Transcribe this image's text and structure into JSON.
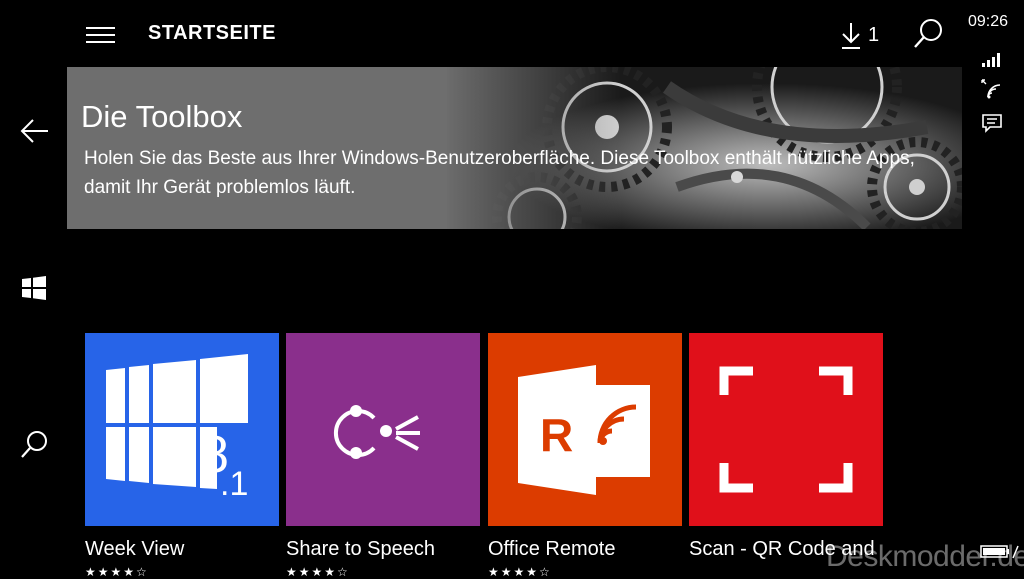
{
  "header": {
    "title": "STARTSEITE",
    "download_count": "1"
  },
  "status_bar": {
    "time": "09:26"
  },
  "hero": {
    "title": "Die Toolbox",
    "description": "Holen Sie das Beste aus Ihrer Windows-Benutzeroberfläche. Diese Toolbox enthält nützliche Apps, damit Ihr Gerät problemlos läuft."
  },
  "apps": [
    {
      "name": "Week View",
      "color": "#2764e8",
      "rating_stars": "★★★★☆"
    },
    {
      "name": "Share to Speech",
      "color": "#8a2f8c",
      "rating_stars": "★★★★☆"
    },
    {
      "name": "Office Remote",
      "color": "#dc3c00",
      "rating_stars": "★★★★☆"
    },
    {
      "name": "Scan - QR Code and",
      "color": "#e0101a",
      "rating_stars": ""
    }
  ],
  "watermark": "Deskmodder.de",
  "icons": [
    "hamburger-icon",
    "back-arrow-icon",
    "windows-logo-icon",
    "search-icon",
    "download-icon",
    "signal-icon",
    "wifi-icon",
    "message-icon",
    "battery-icon"
  ]
}
